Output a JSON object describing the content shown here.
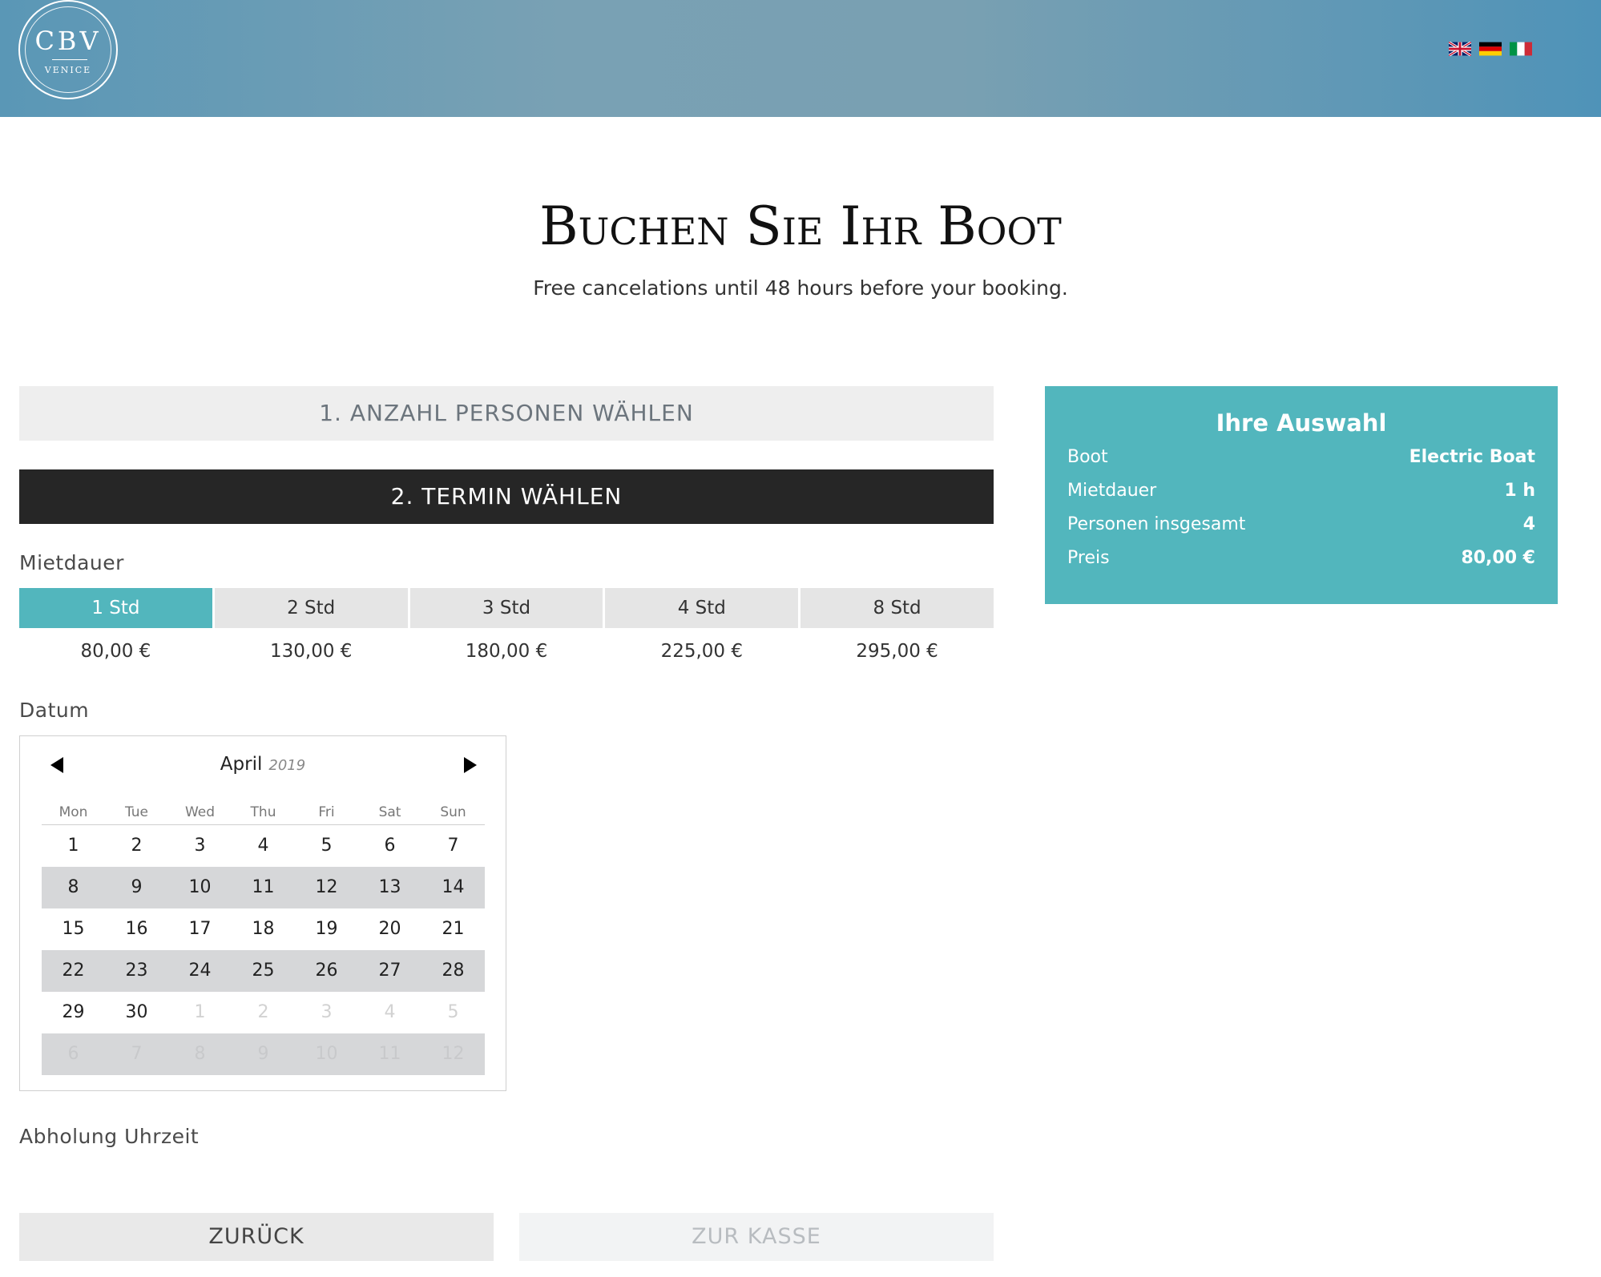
{
  "header": {
    "logo_main": "CBV",
    "logo_sub": "VENICE",
    "languages": [
      "English",
      "Deutsch",
      "Italiano"
    ]
  },
  "page": {
    "title": "Buchen Sie Ihr Boot",
    "subtitle": "Free cancelations until 48 hours before your booking."
  },
  "steps": {
    "step1": "1. ANZAHL PERSONEN WÄHLEN",
    "step2": "2. TERMIN WÄHLEN"
  },
  "duration": {
    "label": "Mietdauer",
    "options": [
      {
        "label": "1 Std",
        "price": "80,00 €",
        "selected": true
      },
      {
        "label": "2 Std",
        "price": "130,00 €",
        "selected": false
      },
      {
        "label": "3 Std",
        "price": "180,00 €",
        "selected": false
      },
      {
        "label": "4 Std",
        "price": "225,00 €",
        "selected": false
      },
      {
        "label": "8 Std",
        "price": "295,00 €",
        "selected": false
      }
    ]
  },
  "date": {
    "label": "Datum",
    "calendar": {
      "month": "April",
      "year": "2019",
      "weekdays": [
        "Mon",
        "Tue",
        "Wed",
        "Thu",
        "Fri",
        "Sat",
        "Sun"
      ],
      "weeks": [
        [
          [
            "1",
            0
          ],
          [
            "2",
            0
          ],
          [
            "3",
            0
          ],
          [
            "4",
            0
          ],
          [
            "5",
            0
          ],
          [
            "6",
            0
          ],
          [
            "7",
            0
          ]
        ],
        [
          [
            "8",
            0
          ],
          [
            "9",
            0
          ],
          [
            "10",
            0
          ],
          [
            "11",
            0
          ],
          [
            "12",
            0
          ],
          [
            "13",
            0
          ],
          [
            "14",
            0
          ]
        ],
        [
          [
            "15",
            0
          ],
          [
            "16",
            0
          ],
          [
            "17",
            0
          ],
          [
            "18",
            0
          ],
          [
            "19",
            0
          ],
          [
            "20",
            0
          ],
          [
            "21",
            0
          ]
        ],
        [
          [
            "22",
            0
          ],
          [
            "23",
            0
          ],
          [
            "24",
            0
          ],
          [
            "25",
            0
          ],
          [
            "26",
            0
          ],
          [
            "27",
            0
          ],
          [
            "28",
            0
          ]
        ],
        [
          [
            "29",
            0
          ],
          [
            "30",
            0
          ],
          [
            "1",
            1
          ],
          [
            "2",
            1
          ],
          [
            "3",
            1
          ],
          [
            "4",
            1
          ],
          [
            "5",
            1
          ]
        ],
        [
          [
            "6",
            1
          ],
          [
            "7",
            1
          ],
          [
            "8",
            1
          ],
          [
            "9",
            1
          ],
          [
            "10",
            1
          ],
          [
            "11",
            1
          ],
          [
            "12",
            1
          ]
        ]
      ]
    }
  },
  "pickup": {
    "label": "Abholung Uhrzeit"
  },
  "buttons": {
    "back": "ZURÜCK",
    "checkout": "ZUR KASSE"
  },
  "summary": {
    "title": "Ihre Auswahl",
    "rows": [
      {
        "key": "Boot",
        "value": "Electric Boat"
      },
      {
        "key": "Mietdauer",
        "value": "1 h"
      },
      {
        "key": "Personen insgesamt",
        "value": "4"
      },
      {
        "key": "Preis",
        "value": "80,00 €"
      }
    ]
  },
  "colors": {
    "accent": "#52b6bd",
    "dark_bar": "#262626",
    "header_blue": "#79a1b4"
  }
}
